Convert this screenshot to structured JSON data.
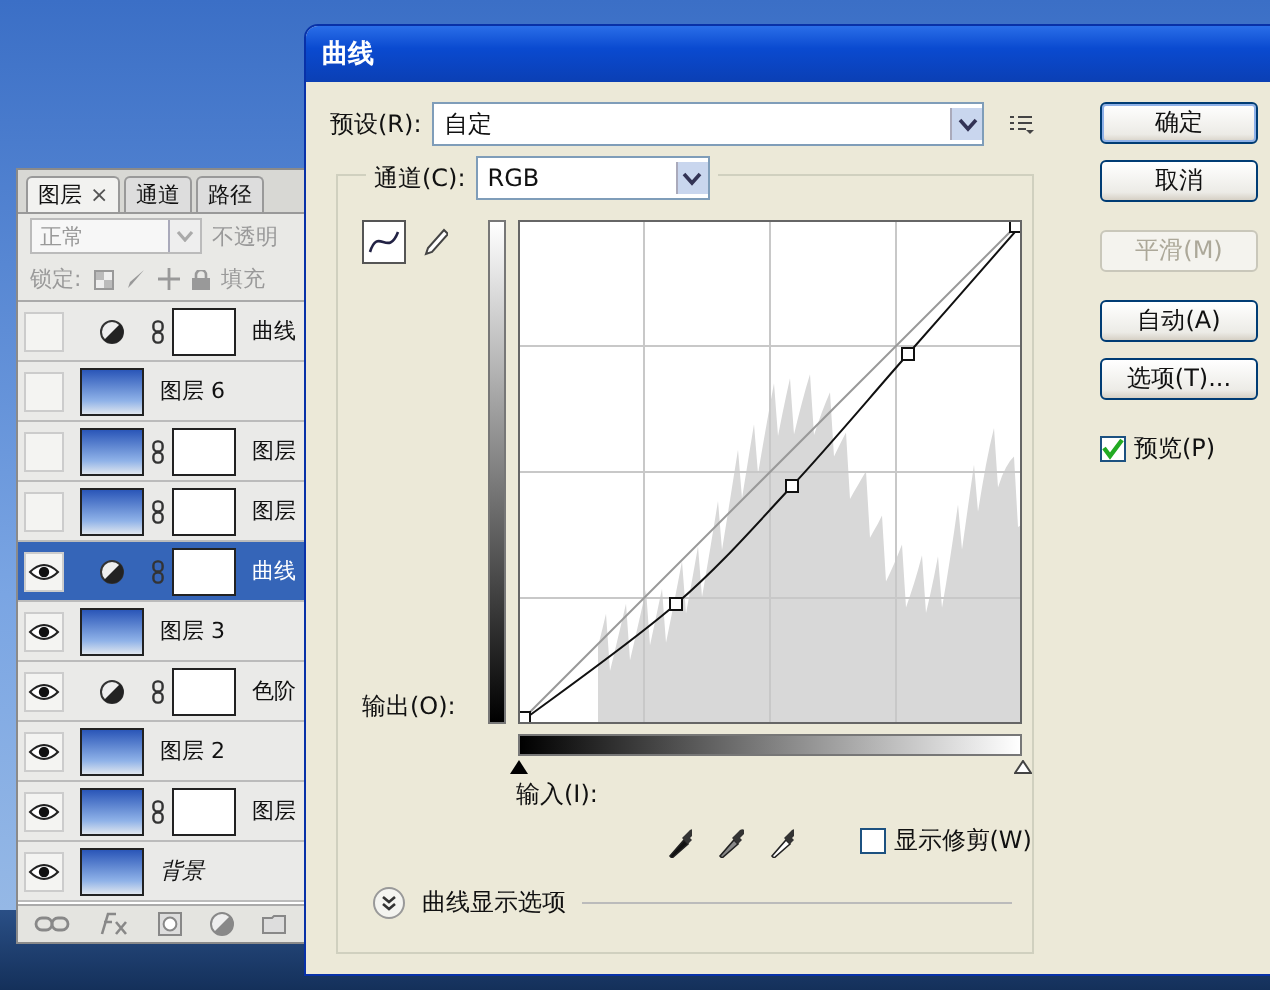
{
  "layers_panel": {
    "tabs": [
      {
        "label": "图层",
        "close": "×",
        "selected": true
      },
      {
        "label": "通道",
        "selected": false
      },
      {
        "label": "路径",
        "selected": false
      }
    ],
    "blend_mode": "正常",
    "opacity_label": "不透明",
    "lock_label": "锁定:",
    "fill_label": "填充",
    "layers": [
      {
        "name": "曲线",
        "kind": "adjustment",
        "visible": false,
        "mask": true,
        "selected": false
      },
      {
        "name": "图层 6",
        "kind": "pixel",
        "visible": false,
        "mask": false,
        "selected": false
      },
      {
        "name": "图层",
        "kind": "pixel",
        "visible": false,
        "mask": true,
        "selected": false
      },
      {
        "name": "图层",
        "kind": "pixel",
        "visible": false,
        "mask": true,
        "selected": false
      },
      {
        "name": "曲线",
        "kind": "adjustment",
        "visible": true,
        "mask": true,
        "selected": true
      },
      {
        "name": "图层 3",
        "kind": "pixel",
        "visible": true,
        "mask": false,
        "selected": false
      },
      {
        "name": "色阶",
        "kind": "adjustment",
        "visible": true,
        "mask": true,
        "selected": false
      },
      {
        "name": "图层 2",
        "kind": "pixel",
        "visible": true,
        "mask": false,
        "selected": false
      },
      {
        "name": "图层",
        "kind": "pixel",
        "visible": true,
        "mask": true,
        "selected": false
      },
      {
        "name": "背景",
        "kind": "background",
        "visible": true,
        "mask": false,
        "selected": false
      }
    ]
  },
  "window": {
    "title": "曲线"
  },
  "preset": {
    "label": "预设(R):",
    "value": "自定"
  },
  "channel": {
    "label": "通道(C):",
    "value": "RGB"
  },
  "tools": [
    {
      "kind": "curve",
      "selected": true
    },
    {
      "kind": "pencil",
      "selected": false
    }
  ],
  "output_label": "输出(O):",
  "input_label": "输入(I):",
  "show_clipping": {
    "label": "显示修剪(W)",
    "checked": false
  },
  "display_options": "曲线显示选项",
  "buttons": [
    {
      "label": "确定",
      "default": true,
      "disabled": false
    },
    {
      "label": "取消",
      "default": false,
      "disabled": false
    },
    {
      "label": "平滑(M)",
      "default": false,
      "disabled": true
    },
    {
      "label": "自动(A)",
      "default": false,
      "disabled": false
    },
    {
      "label": "选项(T)...",
      "default": false,
      "disabled": false
    }
  ],
  "preview": {
    "label": "预览(P)",
    "checked": true
  }
}
